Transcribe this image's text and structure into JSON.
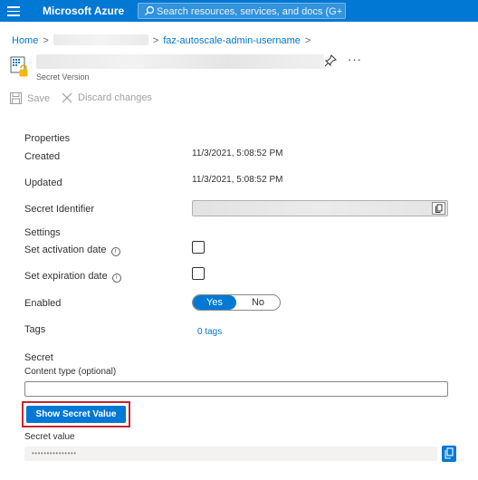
{
  "topbar": {
    "brand": "Microsoft Azure",
    "search_placeholder": "Search resources, services, and docs (G+/)",
    "brand_color": "#0078d4"
  },
  "breadcrumb": {
    "home": "Home",
    "current": "faz-autoscale-admin-username",
    "separator": ">"
  },
  "header": {
    "subtitle": "Secret Version",
    "more_label": "···"
  },
  "toolbar": {
    "save": "Save",
    "discard": "Discard changes"
  },
  "properties": {
    "heading": "Properties",
    "created_label": "Created",
    "created_value": "11/3/2021, 5:08:52 PM",
    "updated_label": "Updated",
    "updated_value": "11/3/2021, 5:08:52 PM",
    "identifier_label": "Secret Identifier"
  },
  "settings": {
    "heading": "Settings",
    "activation_label": "Set activation date",
    "expiration_label": "Set expiration date",
    "info_glyph": "i",
    "enabled_label": "Enabled",
    "enabled_yes": "Yes",
    "enabled_no": "No",
    "enabled_value": "Yes",
    "tags_label": "Tags",
    "tags_value": "0 tags"
  },
  "secret": {
    "heading": "Secret",
    "content_type_label": "Content type (optional)",
    "content_type_value": "",
    "show_button": "Show Secret Value",
    "value_label": "Secret value",
    "value_masked": "•••••••••••••••"
  },
  "colors": {
    "accent": "#0078d4",
    "highlight_frame": "#c4262e"
  }
}
